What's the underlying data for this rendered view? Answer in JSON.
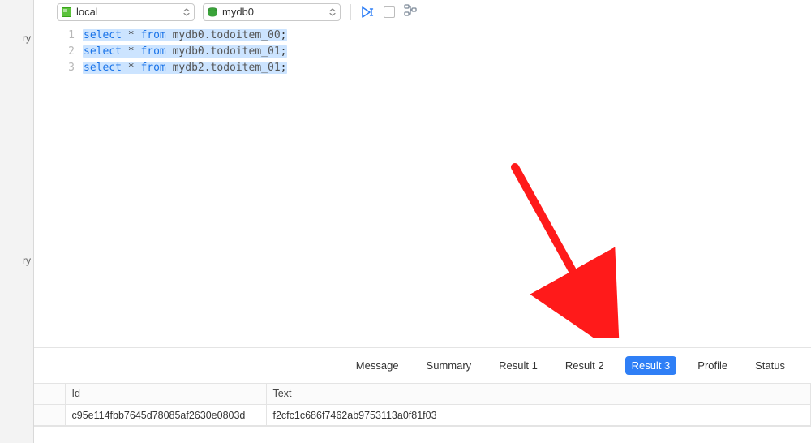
{
  "sidebar": {
    "label1": "ry",
    "label2": "ry"
  },
  "toolbar": {
    "server": {
      "label": "local"
    },
    "database": {
      "label": "mydb0"
    }
  },
  "editor": {
    "lines": [
      {
        "num": "1",
        "kw1": "select",
        "star": "*",
        "kw2": "from",
        "ident": "mydb0.todoitem_00",
        "semi": ";",
        "highlighted": true
      },
      {
        "num": "2",
        "kw1": "select",
        "star": "*",
        "kw2": "from",
        "ident": "mydb0.todoitem_01",
        "semi": ";",
        "highlighted": true
      },
      {
        "num": "3",
        "kw1": "select",
        "star": "*",
        "kw2": "from",
        "ident": "mydb2.todoitem_01",
        "semi": ";",
        "highlighted": true
      }
    ]
  },
  "tabs": {
    "items": [
      {
        "label": "Message",
        "active": false
      },
      {
        "label": "Summary",
        "active": false
      },
      {
        "label": "Result 1",
        "active": false
      },
      {
        "label": "Result 2",
        "active": false
      },
      {
        "label": "Result 3",
        "active": true
      },
      {
        "label": "Profile",
        "active": false
      },
      {
        "label": "Status",
        "active": false
      }
    ]
  },
  "result": {
    "columns": {
      "c0": "Id",
      "c1": "Text"
    },
    "rows": [
      {
        "c0": "c95e114fbb7645d78085af2630e0803d",
        "c1": "f2cfc1c686f7462ab9753113a0f81f03"
      }
    ]
  }
}
